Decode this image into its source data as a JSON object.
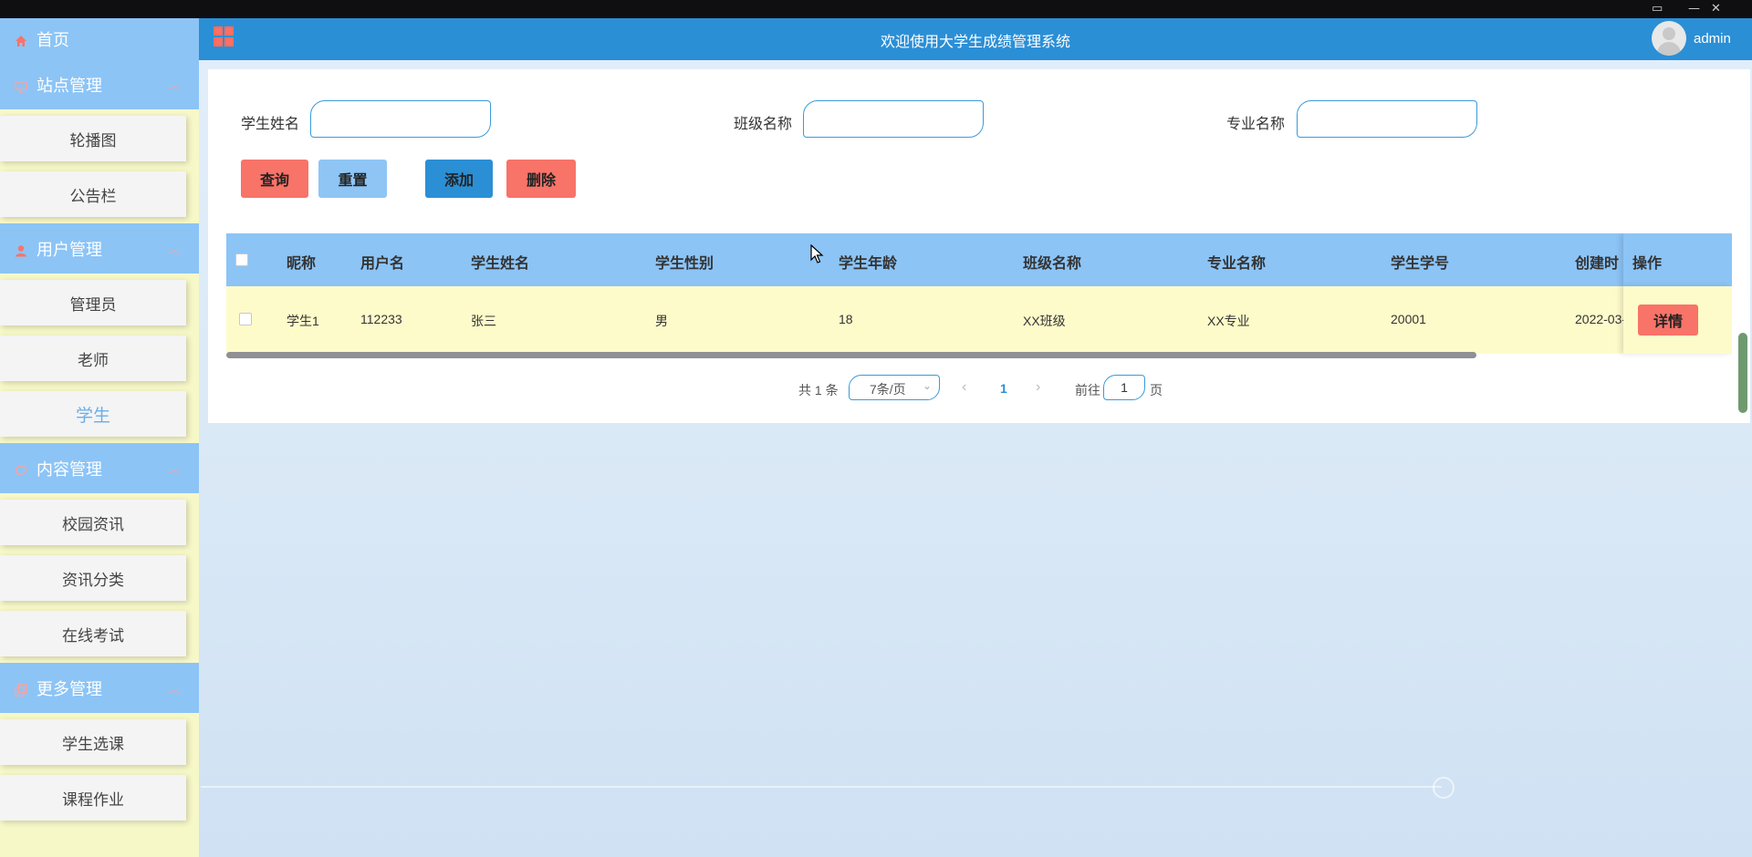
{
  "window": {
    "controls": [
      "▭",
      "—",
      "✕"
    ]
  },
  "sidebar": {
    "home": "首页",
    "groups": [
      {
        "label": "站点管理",
        "icon": "monitor-icon",
        "items": [
          "轮播图",
          "公告栏"
        ]
      },
      {
        "label": "用户管理",
        "icon": "user-icon",
        "items": [
          "管理员",
          "老师",
          "学生"
        ]
      },
      {
        "label": "内容管理",
        "icon": "chat-icon",
        "items": [
          "校园资讯",
          "资讯分类",
          "在线考试"
        ]
      },
      {
        "label": "更多管理",
        "icon": "copy-icon",
        "items": [
          "学生选课",
          "课程作业"
        ]
      }
    ],
    "active_item": "学生",
    "colors": {
      "header_bg": "#8cc4f6",
      "item_bg": "#f4f4f4",
      "icon_color": "#f87368",
      "active_text": "#6aaee8"
    }
  },
  "header": {
    "title": "欢迎使用大学生成绩管理系统",
    "username": "admin",
    "menu_icon": "grid-icon",
    "bg_color": "#2b8fd6"
  },
  "filters": {
    "student_name": {
      "label": "学生姓名",
      "value": ""
    },
    "class_name": {
      "label": "班级名称",
      "value": ""
    },
    "major_name": {
      "label": "专业名称",
      "value": ""
    }
  },
  "buttons": {
    "query": "查询",
    "reset": "重置",
    "add": "添加",
    "delete": "删除",
    "detail": "详情"
  },
  "table": {
    "columns": [
      "昵称",
      "用户名",
      "学生姓名",
      "学生性别",
      "学生年龄",
      "班级名称",
      "专业名称",
      "学生学号",
      "创建时",
      "操作"
    ],
    "rows": [
      {
        "nickname": "学生1",
        "username": "112233",
        "student_name": "张三",
        "gender": "男",
        "age": "18",
        "class_name": "XX班级",
        "major": "XX专业",
        "student_no": "20001",
        "created": "2022-03-"
      }
    ]
  },
  "pagination": {
    "total": "共 1 条",
    "page_size": "7条/页",
    "current_page": "1",
    "goto_label": "前往",
    "goto_value": "1",
    "page_unit": "页"
  }
}
